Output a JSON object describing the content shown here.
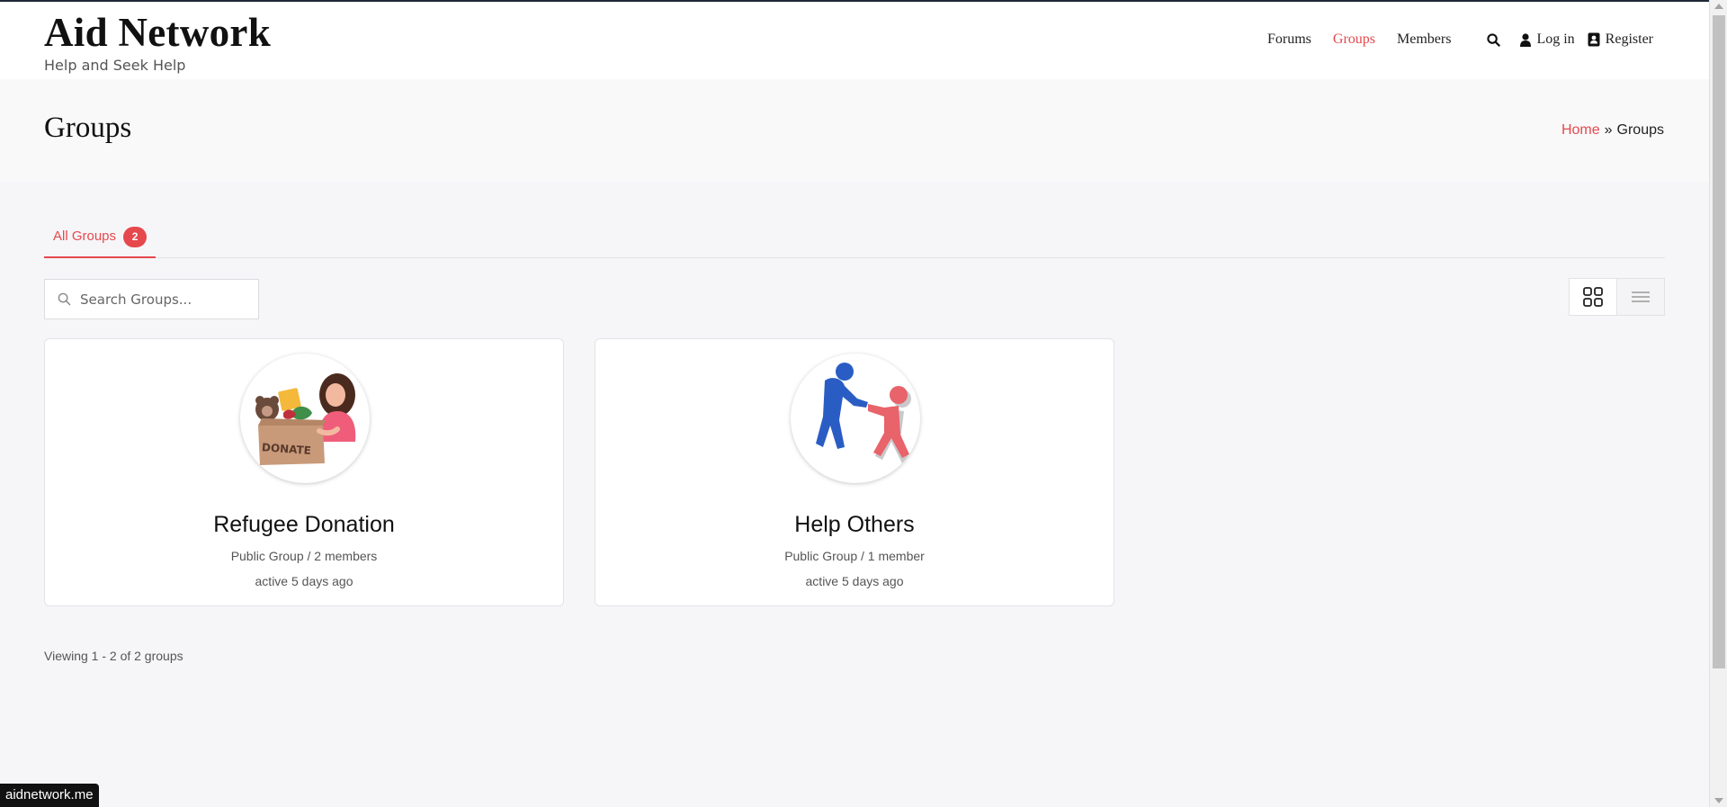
{
  "site": {
    "title": "Aid Network",
    "tagline": "Help and Seek Help"
  },
  "nav": {
    "items": [
      {
        "label": "Forums",
        "active": false
      },
      {
        "label": "Groups",
        "active": true
      },
      {
        "label": "Members",
        "active": false
      }
    ],
    "login_label": "Log in",
    "register_label": "Register"
  },
  "page": {
    "title": "Groups",
    "breadcrumb": {
      "home": "Home",
      "separator": "»",
      "current": "Groups"
    }
  },
  "tabs": [
    {
      "label": "All Groups",
      "count": "2"
    }
  ],
  "search": {
    "placeholder": "Search Groups..."
  },
  "groups": [
    {
      "name": "Refugee Donation",
      "meta": "Public Group / 2 members",
      "activity": "active 5 days ago",
      "avatar_icon": "donation-box-avatar"
    },
    {
      "name": "Help Others",
      "meta": "Public Group / 1 member",
      "activity": "active 5 days ago",
      "avatar_icon": "helping-hand-avatar"
    }
  ],
  "pagination": {
    "info": "Viewing 1 - 2 of 2 groups"
  },
  "status_bar": {
    "url": "aidnetwork.me"
  },
  "colors": {
    "accent": "#e5484d",
    "text": "#222222",
    "muted": "#555555",
    "page_bg": "#f6f6f8"
  }
}
